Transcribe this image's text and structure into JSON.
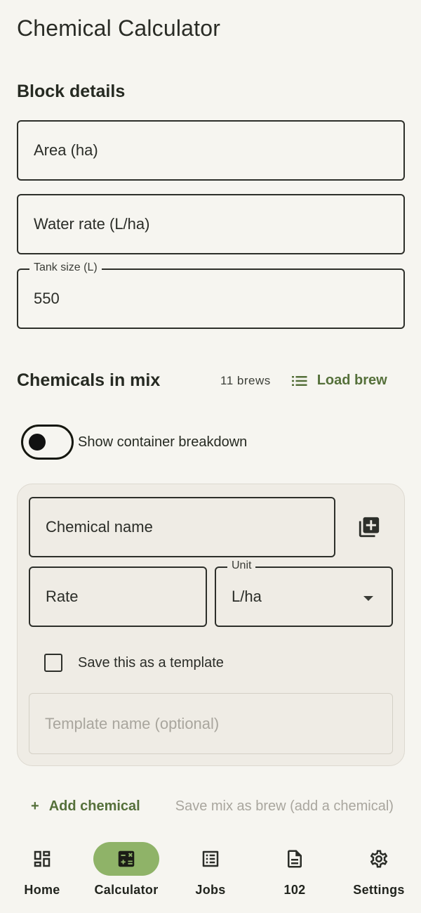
{
  "app": {
    "title": "Chemical Calculator"
  },
  "block_details": {
    "title": "Block details",
    "area": {
      "placeholder": "Area (ha)"
    },
    "water_rate": {
      "placeholder": "Water rate (L/ha)"
    },
    "tank_size": {
      "label": "Tank size (L)",
      "value": "550"
    }
  },
  "chemicals": {
    "title": "Chemicals in mix",
    "brew_count": "11 brews",
    "load_brew": "Load brew",
    "toggle_label": "Show container breakdown",
    "card": {
      "chemical_name_placeholder": "Chemical name",
      "rate_placeholder": "Rate",
      "unit_label": "Unit",
      "unit_value": "L/ha",
      "save_template_label": "Save this as a template",
      "template_name_placeholder": "Template name (optional)"
    },
    "add_chemical": "Add chemical",
    "save_mix": "Save mix as brew (add a chemical)"
  },
  "nav": {
    "items": [
      {
        "label": "Home",
        "icon": "home-grid-icon"
      },
      {
        "label": "Calculator",
        "icon": "calculator-icon",
        "active": true
      },
      {
        "label": "Jobs",
        "icon": "list-icon"
      },
      {
        "label": "102",
        "icon": "document-icon"
      },
      {
        "label": "Settings",
        "icon": "gear-icon"
      }
    ]
  },
  "colors": {
    "accent": "#55703a",
    "active_nav": "#8fb368",
    "background": "#f6f5f0",
    "card": "#efece5"
  }
}
